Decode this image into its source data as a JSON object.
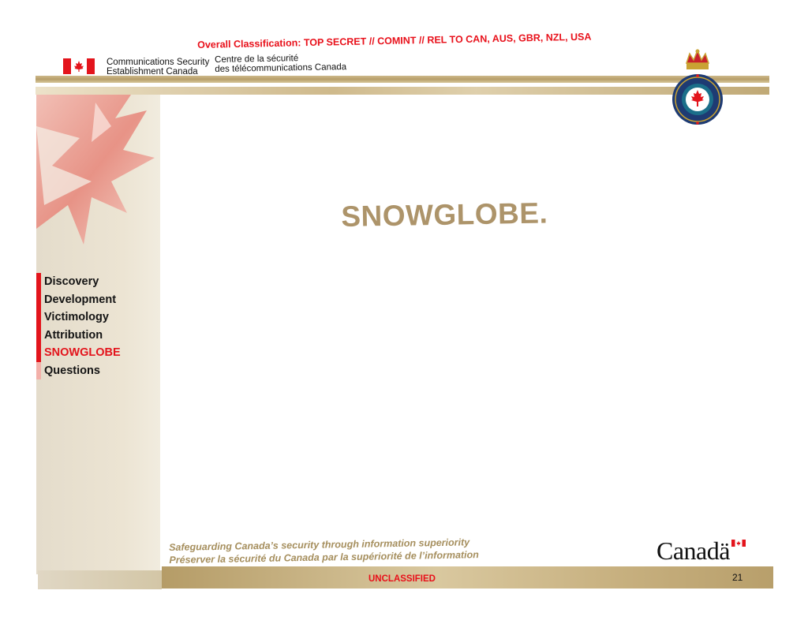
{
  "header": {
    "classification": "Overall Classification: TOP SECRET // COMINT // REL TO CAN, AUS, GBR, NZL, USA",
    "org_name_en_line1": "Communications Security",
    "org_name_en_line2": "Establishment Canada",
    "org_name_fr_line1": "Centre de la sécurité",
    "org_name_fr_line2": "des télécommunications Canada"
  },
  "sidebar": {
    "nav_items": [
      {
        "label": "Discovery"
      },
      {
        "label": "Development"
      },
      {
        "label": "Victimology"
      },
      {
        "label": "Attribution"
      },
      {
        "label": "SNOWGLOBE"
      },
      {
        "label": "Questions"
      }
    ],
    "current_index": 4
  },
  "main": {
    "title": "SNOWGLOBE."
  },
  "footer": {
    "tagline_en": "Safeguarding Canada’s security through information superiority",
    "tagline_fr": "Préserver la sécurité du Canada par la supériorité de l’information",
    "wordmark": "Canadä",
    "marking": "UNCLASSIFIED",
    "page_number": "21"
  },
  "colors": {
    "accent_red": "#e3141c",
    "title_gold": "#ad946a",
    "bar_gold": "#b59c67"
  }
}
